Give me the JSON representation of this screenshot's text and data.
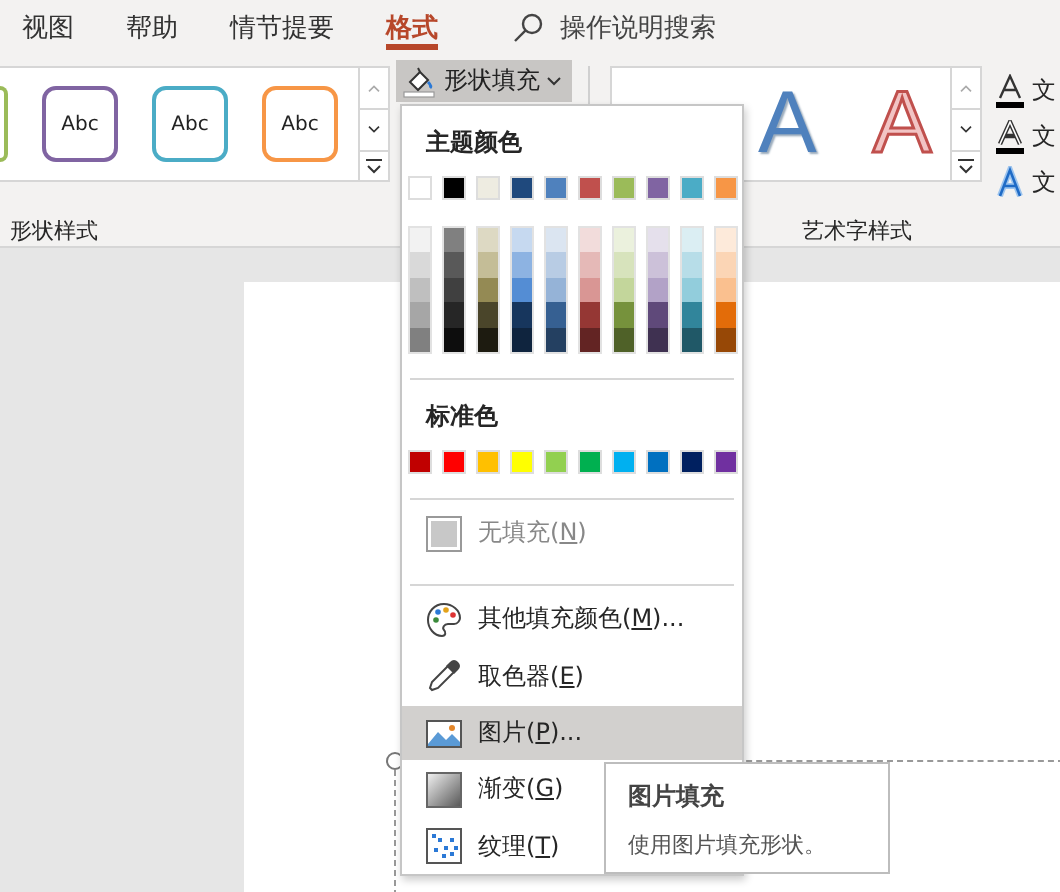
{
  "tabs": [
    {
      "label": "视图",
      "selected": false
    },
    {
      "label": "帮助",
      "selected": false
    },
    {
      "label": "情节提要",
      "selected": false
    },
    {
      "label": "格式",
      "selected": true
    }
  ],
  "search": {
    "placeholder": "操作说明搜索"
  },
  "shape_styles": {
    "label": "形状样式",
    "items": [
      {
        "color": "#9bbb59"
      },
      {
        "label": "Abc",
        "color": "#8064a2"
      },
      {
        "label": "Abc",
        "color": "#4bacc6"
      },
      {
        "label": "Abc",
        "color": "#f79646"
      }
    ]
  },
  "shape_fill_button": {
    "label": "形状填充",
    "pressed": true
  },
  "wordart_styles": {
    "label": "艺术字样式",
    "items": [
      {
        "text": "A",
        "kind": "fill"
      },
      {
        "text": "A",
        "kind": "outline"
      }
    ]
  },
  "text_commands": [
    {
      "kind": "fill",
      "text": "文"
    },
    {
      "kind": "outline",
      "text": "文"
    },
    {
      "kind": "effects",
      "text": "文"
    }
  ],
  "fill_menu": {
    "theme_heading": "主题颜色",
    "theme_colors": [
      {
        "color": "#ffffff",
        "shades": [
          {
            "color": "#f2f2f2"
          },
          {
            "color": "#d9d9d9"
          },
          {
            "color": "#bfbfbf"
          },
          {
            "color": "#a6a6a6"
          },
          {
            "color": "#808080"
          }
        ]
      },
      {
        "color": "#000000",
        "shades": [
          {
            "color": "#808080"
          },
          {
            "color": "#595959"
          },
          {
            "color": "#404040"
          },
          {
            "color": "#262626"
          },
          {
            "color": "#0d0d0d"
          }
        ]
      },
      {
        "color": "#eeece1",
        "shades": [
          {
            "color": "#ddd9c3"
          },
          {
            "color": "#c4bd97"
          },
          {
            "color": "#948a54"
          },
          {
            "color": "#4a452a"
          },
          {
            "color": "#1d1b10"
          }
        ]
      },
      {
        "color": "#1f497d",
        "shades": [
          {
            "color": "#c6d9f0"
          },
          {
            "color": "#8db3e2"
          },
          {
            "color": "#548dd4"
          },
          {
            "color": "#17365d"
          },
          {
            "color": "#0f243e"
          }
        ]
      },
      {
        "color": "#4f81bd",
        "shades": [
          {
            "color": "#dbe5f1"
          },
          {
            "color": "#b8cce4"
          },
          {
            "color": "#95b3d7"
          },
          {
            "color": "#366092"
          },
          {
            "color": "#244061"
          }
        ]
      },
      {
        "color": "#c0504d",
        "shades": [
          {
            "color": "#f2dcdb"
          },
          {
            "color": "#e5b9b7"
          },
          {
            "color": "#d99694"
          },
          {
            "color": "#953734"
          },
          {
            "color": "#632423"
          }
        ]
      },
      {
        "color": "#9bbb59",
        "shades": [
          {
            "color": "#ebf1dd"
          },
          {
            "color": "#d7e3bc"
          },
          {
            "color": "#c3d69b"
          },
          {
            "color": "#76923c"
          },
          {
            "color": "#4f6128"
          }
        ]
      },
      {
        "color": "#8064a2",
        "shades": [
          {
            "color": "#e5e0ec"
          },
          {
            "color": "#ccc1d9"
          },
          {
            "color": "#b2a2c7"
          },
          {
            "color": "#5f497a"
          },
          {
            "color": "#3f3151"
          }
        ]
      },
      {
        "color": "#4bacc6",
        "shades": [
          {
            "color": "#dbeef3"
          },
          {
            "color": "#b7dde8"
          },
          {
            "color": "#92cddc"
          },
          {
            "color": "#31859b"
          },
          {
            "color": "#205867"
          }
        ]
      },
      {
        "color": "#f79646",
        "shades": [
          {
            "color": "#fdeada"
          },
          {
            "color": "#fbd5b5"
          },
          {
            "color": "#fac08f"
          },
          {
            "color": "#e36c09"
          },
          {
            "color": "#974806"
          }
        ]
      }
    ],
    "standard_heading": "标准色",
    "standard_colors": [
      {
        "color": "#c00000"
      },
      {
        "color": "#ff0000"
      },
      {
        "color": "#ffc000"
      },
      {
        "color": "#ffff00"
      },
      {
        "color": "#92d050"
      },
      {
        "color": "#00b050"
      },
      {
        "color": "#00b0f0"
      },
      {
        "color": "#0070c0"
      },
      {
        "color": "#002060"
      },
      {
        "color": "#7030a0"
      }
    ],
    "items": [
      {
        "kind": "none",
        "label": "无填充(",
        "key": "N",
        "tail": ")",
        "disabled": true,
        "selected": false
      },
      {
        "kind": "palette",
        "label": "其他填充颜色(",
        "key": "M",
        "tail": ")...",
        "disabled": false,
        "selected": false
      },
      {
        "kind": "eyedropper",
        "label": "取色器(",
        "key": "E",
        "tail": ")",
        "disabled": false,
        "selected": false
      },
      {
        "kind": "picture",
        "label": "图片(",
        "key": "P",
        "tail": ")...",
        "disabled": false,
        "selected": true
      },
      {
        "kind": "gradient",
        "label": "渐变(",
        "key": "G",
        "tail": ")",
        "disabled": false,
        "selected": false
      },
      {
        "kind": "texture",
        "label": "纹理(",
        "key": "T",
        "tail": ")",
        "disabled": false,
        "selected": false
      }
    ]
  },
  "tooltip": {
    "title": "图片填充",
    "description": "使用图片填充形状。"
  }
}
